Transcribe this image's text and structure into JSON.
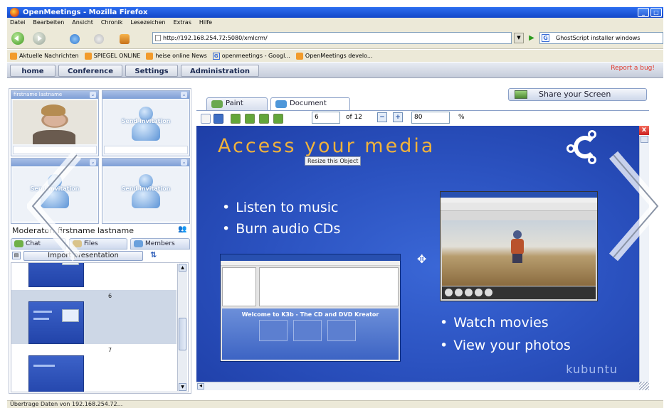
{
  "browser": {
    "window_title": "OpenMeetings - Mozilla Firefox",
    "menu": [
      "Datei",
      "Bearbeiten",
      "Ansicht",
      "Chronik",
      "Lesezeichen",
      "Extras",
      "Hilfe"
    ],
    "url": "http://192.168.254.72:5080/xmlcrm/",
    "search_text": "GhostScript installer windows",
    "bookmarks": [
      "Aktuelle Nachrichten",
      "SPIEGEL ONLINE",
      "heise online News",
      "openmeetings - Googl...",
      "OpenMeetings develo..."
    ],
    "status_text": "Übertrage Daten von 192.168.254.72..."
  },
  "app_nav": {
    "items": [
      "home",
      "Conference",
      "Settings",
      "Administration"
    ],
    "report_bug": "Report a bug!"
  },
  "video": {
    "user_name": "firstname lastname",
    "send_invitation": "Send invitation"
  },
  "left_panel": {
    "moderator": "Moderator: firstname lastname",
    "tabs": [
      "Chat",
      "Files",
      "Members"
    ],
    "import_button": "Import presentation",
    "thumbs": [
      "6",
      "7"
    ]
  },
  "whiteboard": {
    "share_screen": "Share your Screen",
    "tabs": [
      "Paint",
      "Document"
    ],
    "page_value": "6",
    "page_of": "of 12",
    "zoom_value": "80",
    "zoom_unit": "%",
    "resize_tooltip": "Resize this Object",
    "close_label": "x"
  },
  "slide": {
    "title": "Access your media",
    "bullets_left": [
      "Listen to music",
      "Burn audio CDs"
    ],
    "bullets_right": [
      "Watch movies",
      "View your photos"
    ],
    "k3b_welcome": "Welcome to K3b - The CD and DVD Kreator",
    "brand": "kubuntu"
  },
  "colors": {
    "accent": "#1347c8",
    "slide_bg": "#2b52c0",
    "slide_title": "#f0b23b",
    "report_bug": "#e03b2e"
  }
}
